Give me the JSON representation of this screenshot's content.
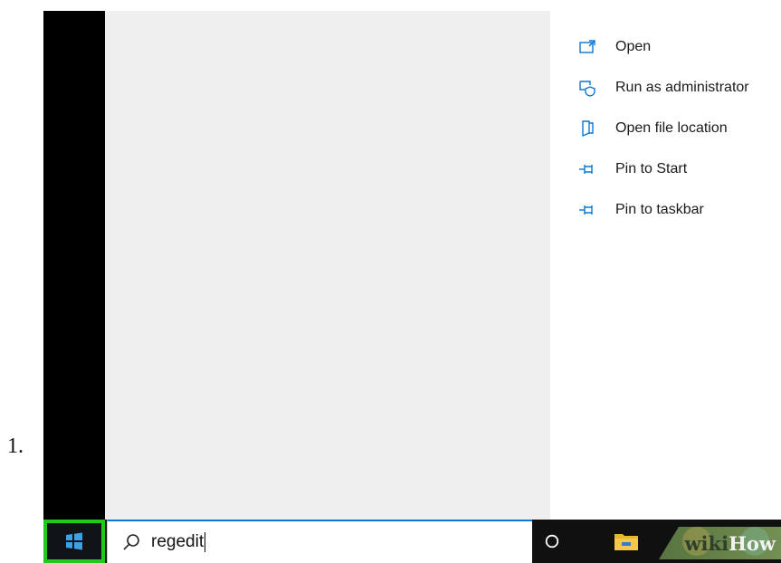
{
  "step": {
    "number": "1."
  },
  "context_menu": {
    "items": [
      {
        "label": "Open",
        "icon": "open-window-icon"
      },
      {
        "label": "Run as administrator",
        "icon": "shield-admin-icon"
      },
      {
        "label": "Open file location",
        "icon": "file-location-icon"
      },
      {
        "label": "Pin to Start",
        "icon": "pin-icon"
      },
      {
        "label": "Pin to taskbar",
        "icon": "pin-icon"
      }
    ]
  },
  "taskbar": {
    "start_icon": "windows-logo-icon",
    "search": {
      "value": "regedit",
      "icon": "search-icon"
    },
    "cortana_icon": "cortana-circle-icon",
    "explorer_icon": "file-explorer-icon"
  },
  "watermark": {
    "part1": "wiki",
    "part2": "How"
  },
  "colors": {
    "accent": "#0a78d4",
    "highlight": "#22c81e"
  }
}
